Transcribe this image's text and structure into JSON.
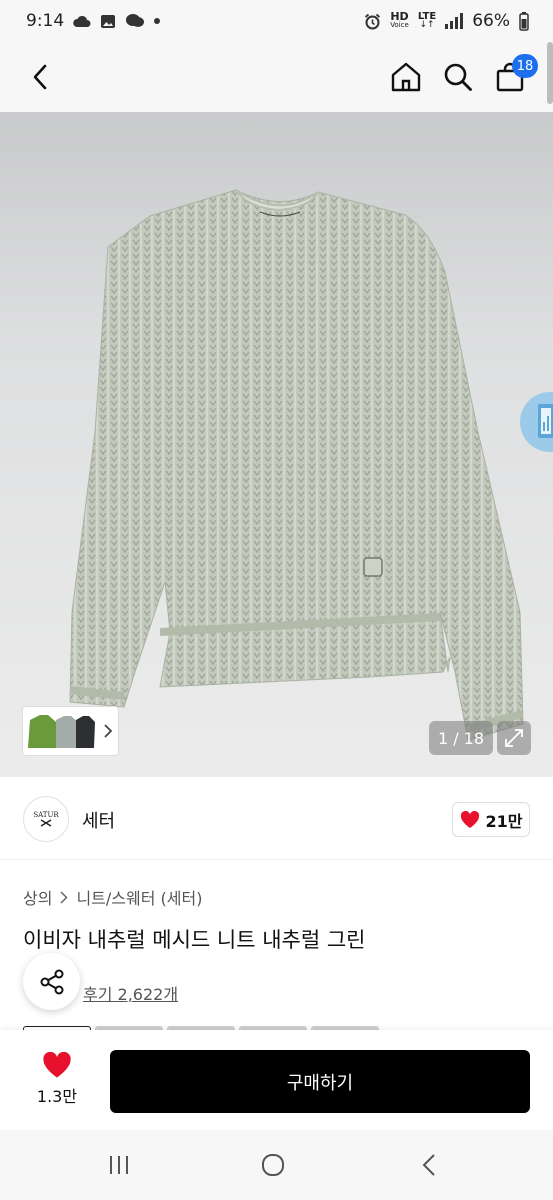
{
  "status_bar": {
    "time": "9:14",
    "hd_top": "HD",
    "hd_bottom": "Voice",
    "lte_label": "LTE",
    "battery": "66%"
  },
  "header": {
    "cart_count": "18"
  },
  "gallery": {
    "counter": "1 / 18",
    "thumb_colors": [
      "#6a9a3a",
      "#a3aca8",
      "#2e2f33"
    ],
    "product_color": "#bcc4b6"
  },
  "brand": {
    "logo_text": "SATUR",
    "name": "세터",
    "like_count": "21만"
  },
  "breadcrumb": {
    "category": "상의",
    "subcategory": "니트/스웨터",
    "brand_tag": "(세터)"
  },
  "product": {
    "title": "이비자 내추럴 메시드 니트 내추럴 그린",
    "reviews": "후기 2,622개"
  },
  "purchase": {
    "wish_count": "1.3만",
    "buy_label": "구매하기"
  },
  "colors": {
    "accent": "#1e6ff0",
    "heart": "#e8112d",
    "buy_button": "#000000"
  }
}
